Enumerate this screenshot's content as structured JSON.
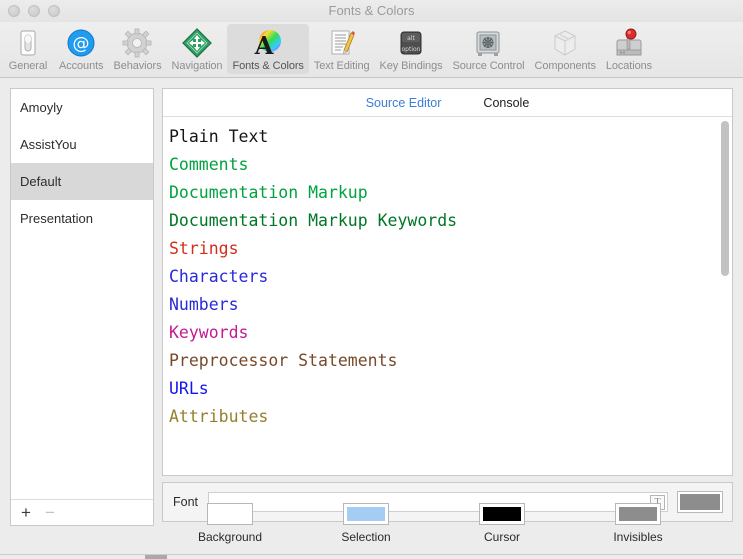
{
  "window": {
    "title": "Fonts & Colors",
    "traffic_lights": [
      "close-button",
      "minimize-button",
      "zoom-button"
    ]
  },
  "toolbar": {
    "items": [
      {
        "label": "General",
        "icon": "general-switch-icon",
        "selected": false
      },
      {
        "label": "Accounts",
        "icon": "at-sign-icon",
        "selected": false
      },
      {
        "label": "Behaviors",
        "icon": "gear-icon",
        "selected": false
      },
      {
        "label": "Navigation",
        "icon": "compass-arrows-icon",
        "selected": false
      },
      {
        "label": "Fonts & Colors",
        "icon": "font-color-wheel-icon",
        "selected": true
      },
      {
        "label": "Text Editing",
        "icon": "document-pencil-icon",
        "selected": false
      },
      {
        "label": "Key Bindings",
        "icon": "option-key-icon",
        "selected": false
      },
      {
        "label": "Source Control",
        "icon": "safe-vault-icon",
        "selected": false
      },
      {
        "label": "Components",
        "icon": "package-box-icon",
        "selected": false
      },
      {
        "label": "Locations",
        "icon": "hard-drive-pin-icon",
        "selected": false
      }
    ]
  },
  "sidebar": {
    "themes": [
      {
        "name": "Amoyly",
        "selected": false
      },
      {
        "name": "AssistYou",
        "selected": false
      },
      {
        "name": "Default",
        "selected": true
      },
      {
        "name": "Presentation",
        "selected": false
      }
    ],
    "add_label": "+",
    "remove_label": "−",
    "remove_disabled": true
  },
  "tabs": [
    {
      "label": "Source Editor",
      "active": true
    },
    {
      "label": "Console",
      "active": false
    }
  ],
  "syntax_items": [
    {
      "label": "Plain Text",
      "color": "#151515"
    },
    {
      "label": "Comments",
      "color": "#00a33f"
    },
    {
      "label": "Documentation Markup",
      "color": "#00a33f"
    },
    {
      "label": "Documentation Markup Keywords",
      "color": "#007724"
    },
    {
      "label": "Strings",
      "color": "#d12f1b"
    },
    {
      "label": "Characters",
      "color": "#272ad8"
    },
    {
      "label": "Numbers",
      "color": "#272ad8"
    },
    {
      "label": "Keywords",
      "color": "#c41a93"
    },
    {
      "label": "Preprocessor Statements",
      "color": "#78492a"
    },
    {
      "label": "URLs",
      "color": "#1414f0"
    },
    {
      "label": "Attributes",
      "color": "#947f2e"
    }
  ],
  "font_row": {
    "label": "Font",
    "value": "",
    "placeholder": "",
    "font_panel_icon": "T",
    "swatch_color": "#8d8d8d"
  },
  "color_swatches": [
    {
      "label": "Background",
      "color": "#ffffff"
    },
    {
      "label": "Selection",
      "color": "#a5cdf4"
    },
    {
      "label": "Cursor",
      "color": "#000000"
    },
    {
      "label": "Invisibles",
      "color": "#8d8d8d"
    }
  ],
  "accent_color": "#3a7fd5"
}
